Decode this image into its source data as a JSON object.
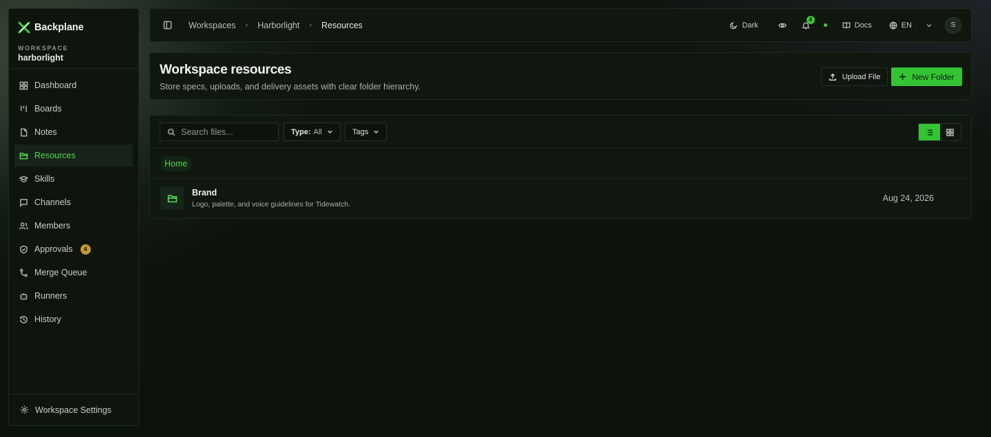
{
  "app": {
    "name": "Backplane"
  },
  "workspace": {
    "label": "WORKSPACE",
    "name": "harborlight"
  },
  "sidebar": {
    "items": [
      {
        "label": "Dashboard",
        "icon": "dashboard-icon"
      },
      {
        "label": "Boards",
        "icon": "boards-icon"
      },
      {
        "label": "Notes",
        "icon": "notes-icon"
      },
      {
        "label": "Resources",
        "icon": "folder-icon",
        "active": true
      },
      {
        "label": "Skills",
        "icon": "graduation-cap-icon"
      },
      {
        "label": "Channels",
        "icon": "message-square-icon"
      },
      {
        "label": "Members",
        "icon": "users-icon"
      },
      {
        "label": "Approvals",
        "icon": "shield-check-icon",
        "badge": "4"
      },
      {
        "label": "Merge Queue",
        "icon": "git-merge-icon"
      },
      {
        "label": "Runners",
        "icon": "bot-icon"
      },
      {
        "label": "History",
        "icon": "history-icon"
      }
    ],
    "footer_label": "Workspace Settings"
  },
  "topbar": {
    "breadcrumbs": [
      "Workspaces",
      "Harborlight",
      "Resources"
    ],
    "theme_label": "Dark",
    "notification_count": "4",
    "docs_label": "Docs",
    "language": "EN",
    "avatar_initial": "S"
  },
  "page": {
    "title": "Workspace resources",
    "subtitle": "Store specs, uploads, and delivery assets with clear folder hierarchy.",
    "upload_label": "Upload File",
    "new_folder_label": "New Folder"
  },
  "files": {
    "search_placeholder": "Search files...",
    "type_filter": {
      "key": "Type:",
      "value": "All"
    },
    "tags_label": "Tags",
    "view_mode": "list",
    "path": [
      "Home"
    ],
    "rows": [
      {
        "name": "Brand",
        "description": "Logo, palette, and voice guidelines for Tidewatch.",
        "date": "Aug 24, 2026",
        "icon": "folder-icon"
      }
    ]
  },
  "colors": {
    "accent": "#33c433",
    "accent_text": "#52d84a",
    "badge": "#c89a35",
    "background": "#0b130b"
  }
}
